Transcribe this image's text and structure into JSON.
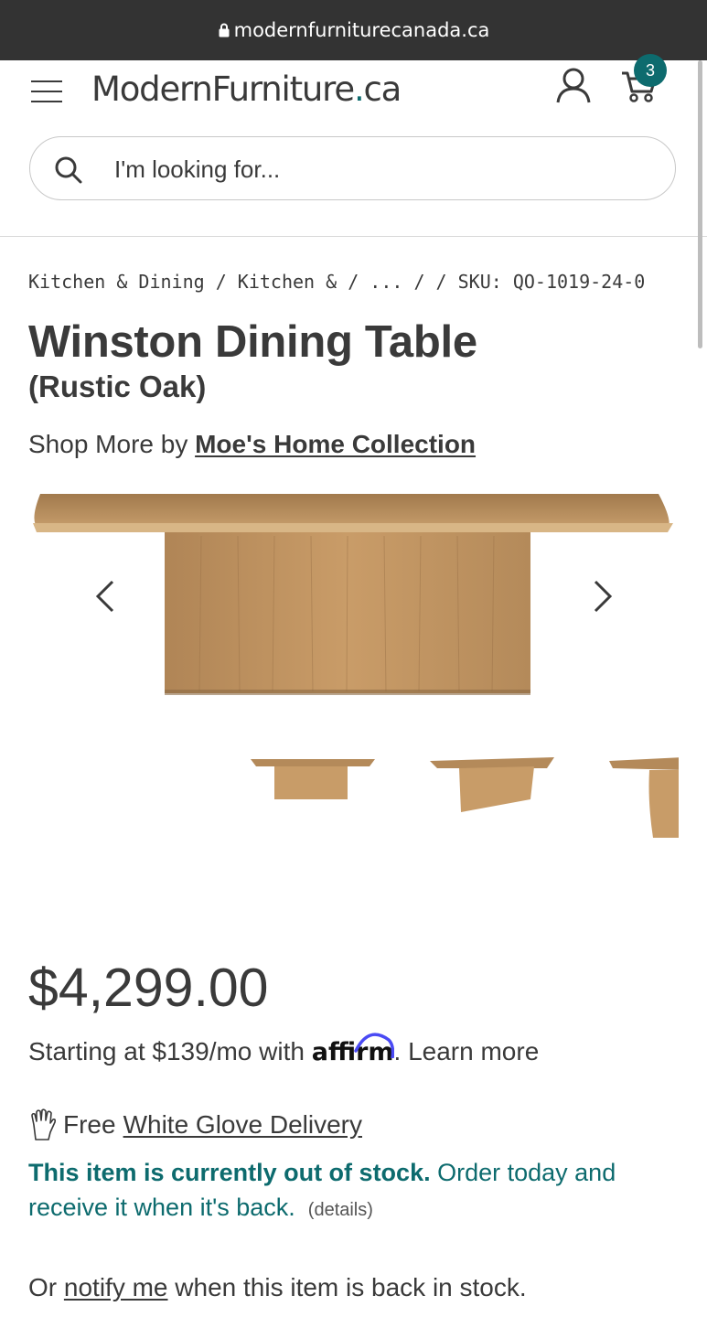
{
  "browser": {
    "url": "modernfurniturecanada.ca"
  },
  "header": {
    "logo_main": "ModernFurniture",
    "logo_dot": ".",
    "logo_tld": "ca",
    "cart_count": "3",
    "search_placeholder": "I'm looking for..."
  },
  "breadcrumb": {
    "items": [
      "Kitchen & Dining",
      "Kitchen &",
      "...",
      ""
    ],
    "separator": " / ",
    "sku": "SKU: QO-1019-24-0"
  },
  "product": {
    "title": "Winston Dining Table",
    "variant": "(Rustic Oak)",
    "shop_more_prefix": "Shop More by ",
    "brand": "Moe's Home Collection",
    "price": "$4,299.00"
  },
  "financing": {
    "prefix": "Starting at $139/mo with ",
    "provider": "affirm",
    "suffix": ". Learn more"
  },
  "delivery": {
    "prefix": "Free",
    "link": "White Glove Delivery"
  },
  "stock": {
    "status_bold": "This item is currently out of stock.",
    "status_rest": " Order today and receive it when it's back.",
    "details": "(details)"
  },
  "notify": {
    "prefix": "Or ",
    "link": "notify me",
    "suffix": " when this item is back in stock."
  },
  "colors": {
    "accent": "#0d6b6e",
    "urlbar": "#333333",
    "text": "#3a3a3a",
    "wood": "#b98f5e"
  },
  "icons": [
    "lock-icon",
    "hamburger-icon",
    "account-icon",
    "cart-icon",
    "search-icon",
    "chevron-left-icon",
    "chevron-right-icon",
    "glove-icon"
  ]
}
